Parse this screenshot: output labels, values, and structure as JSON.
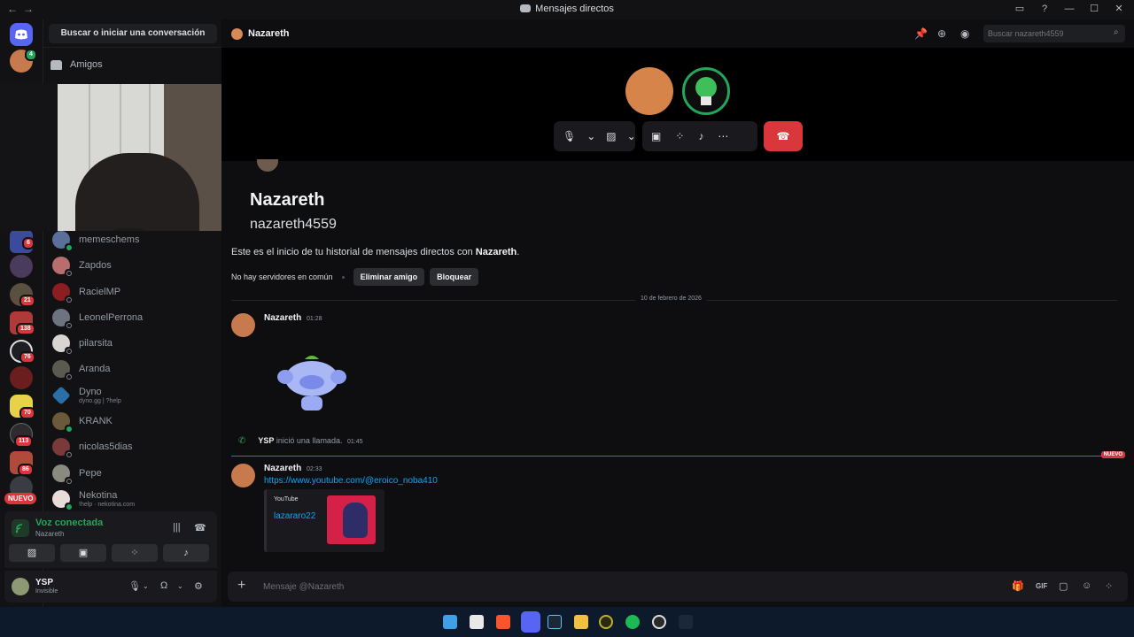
{
  "window": {
    "title": "Mensajes directos",
    "nav_back": "←",
    "nav_forward": "→",
    "controls": {
      "inbox": "▭",
      "help": "?",
      "minimize": "—",
      "maximize": "☐",
      "close": "✕"
    }
  },
  "rail": {
    "badges": {
      "b1": "6",
      "b2": "21",
      "b3": "138",
      "b4": "76",
      "b5": "70",
      "b6": "113",
      "b7": "86"
    },
    "nuevo": "NUEVO",
    "avatar_badge": "4"
  },
  "sidebar": {
    "search_label": "Buscar o iniciar una conversación",
    "friends_label": "Amigos",
    "dms": [
      {
        "name": "memeschems",
        "sub": ""
      },
      {
        "name": "Zapdos",
        "sub": ""
      },
      {
        "name": "RacielMP",
        "sub": ""
      },
      {
        "name": "LeonelPerrona",
        "sub": ""
      },
      {
        "name": "pilarsita",
        "sub": ""
      },
      {
        "name": "Aranda",
        "sub": ""
      },
      {
        "name": "Dyno",
        "sub": "dyno.gg | ?help"
      },
      {
        "name": "KRANK",
        "sub": ""
      },
      {
        "name": "nicolas5dias",
        "sub": ""
      },
      {
        "name": "Pepe",
        "sub": ""
      },
      {
        "name": "Nekotina",
        "sub": "!help · nekotina.com"
      }
    ]
  },
  "voice": {
    "status": "Voz conectada",
    "channel": "Nazareth"
  },
  "user": {
    "name": "YSP",
    "status": "Invisible"
  },
  "chat": {
    "header_name": "Nazareth",
    "search_placeholder": "Buscar nazareth4559",
    "welcome_name": "Nazareth",
    "welcome_user": "nazareth4559",
    "welcome_prefix": "Este es el inicio de tu historial de mensajes directos con ",
    "welcome_bold": "Nazareth",
    "welcome_suffix": ".",
    "no_servers": "No hay servidores en común",
    "remove_friend": "Eliminar amigo",
    "block": "Bloquear",
    "date_divider": "10 de febrero de 2026",
    "new_marker": "NUEVO",
    "messages": [
      {
        "author": "Nazareth",
        "time": "01:28"
      },
      {
        "author": "Nazareth",
        "time": "02:33",
        "link": "https://www.youtube.com/@eroico_noba410"
      }
    ],
    "call_event": {
      "user": "YSP",
      "text": " inició una llamada.",
      "time": "01:45"
    },
    "embed": {
      "provider": "YouTube",
      "title": "lazararo22"
    },
    "composer_placeholder": "Mensaje @Nazareth"
  },
  "colors": {
    "accent_red": "#da373c",
    "online_green": "#23a55a",
    "link_blue": "#00a8fc",
    "blurple": "#5865f2"
  },
  "icons": [
    "search-icon",
    "pin-icon",
    "add-friend-icon",
    "profile-icon",
    "mic-icon",
    "camera-off-icon",
    "screen-share-icon",
    "activities-icon",
    "soundboard-icon",
    "more-icon",
    "hangup-icon",
    "headphones-icon",
    "gear-icon",
    "plus-icon",
    "gift-icon",
    "gif-icon",
    "sticker-icon",
    "emoji-icon",
    "apps-icon",
    "phone-icon"
  ]
}
